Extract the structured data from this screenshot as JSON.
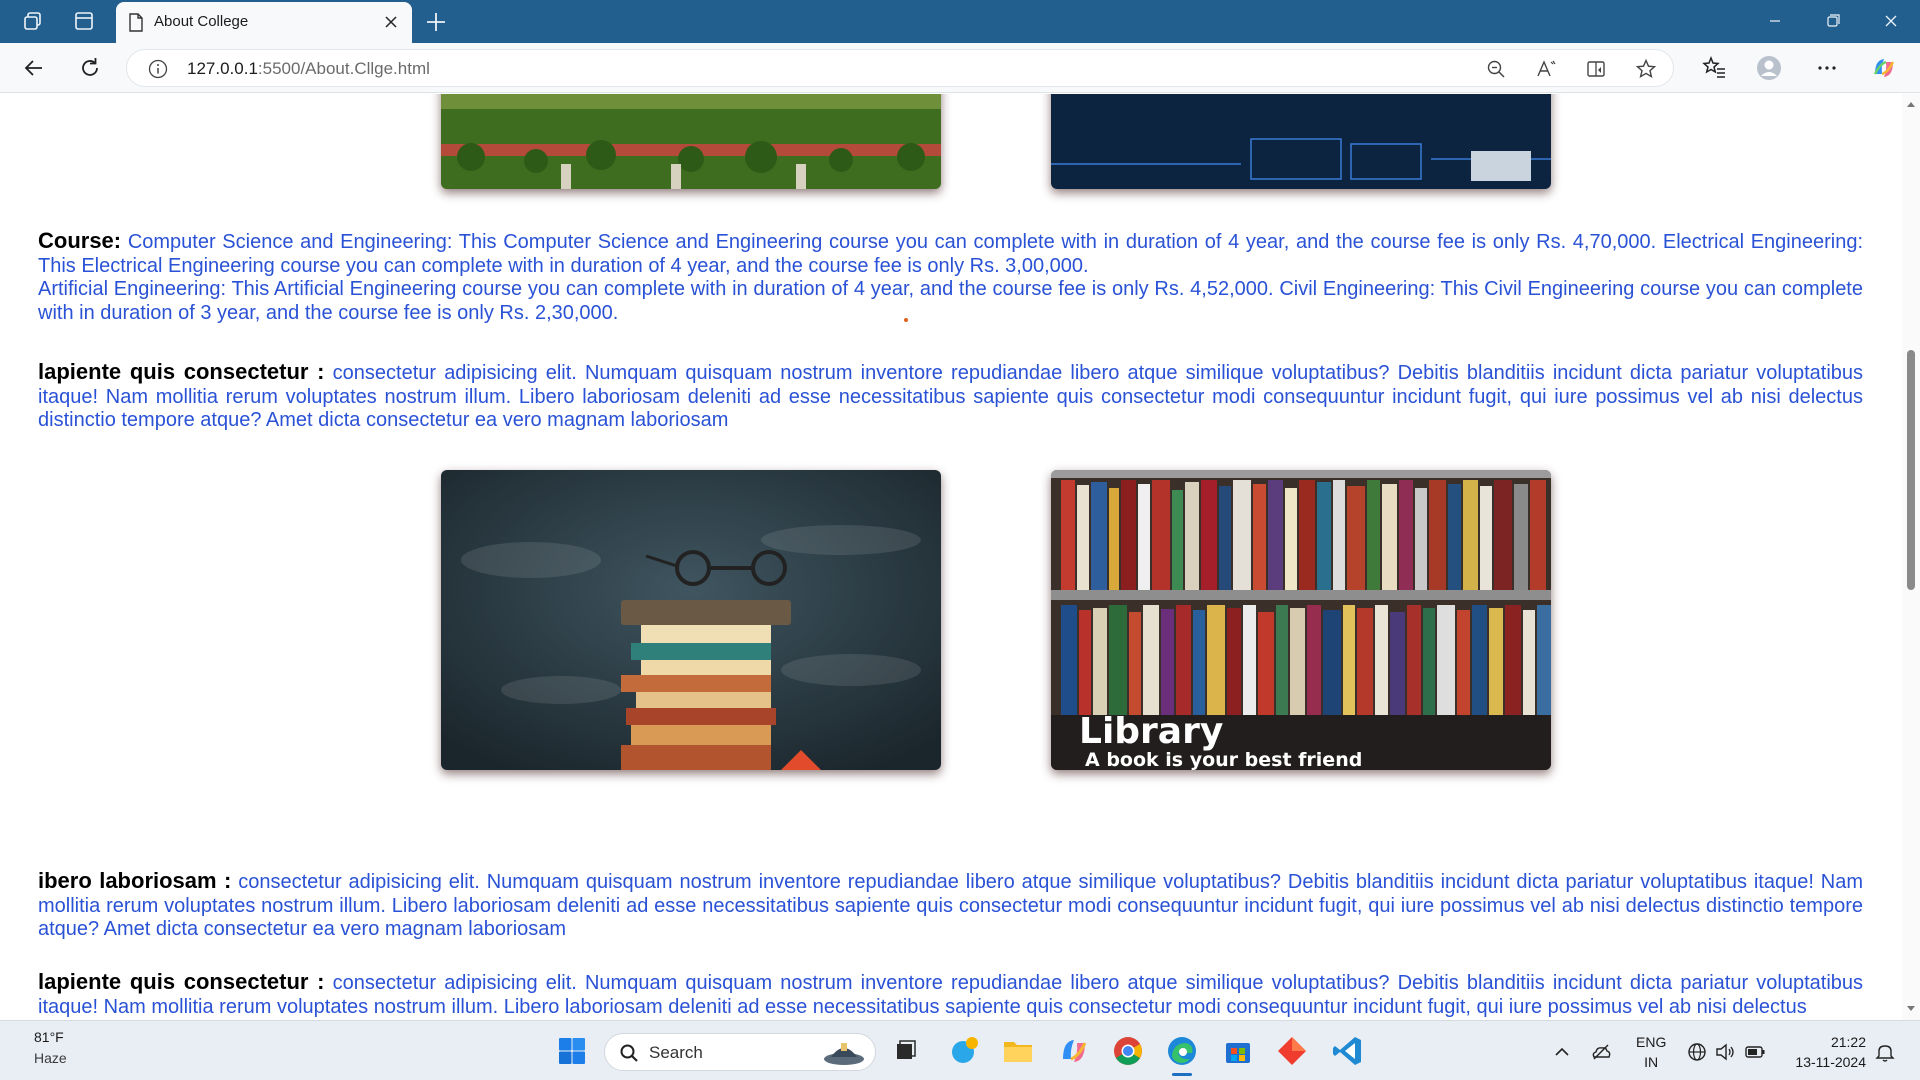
{
  "browser": {
    "tab_title": "About College",
    "url_host": "127.0.0.1",
    "url_rest": ":5500/About.Cllge.html"
  },
  "page": {
    "course_label": "Course:",
    "course_text_1": "Computer Science and Engineering: This Computer Science and Engineering course you can complete with in duration of 4 year, and the course fee is only Rs. 4,70,000. Electrical Engineering: This Electrical Engineering course you can complete with in duration of 4 year, and the course fee is only Rs. 3,00,000.",
    "course_text_2": "Artificial Engineering: This Artificial Engineering course you can complete with in duration of 4 year, and the course fee is only Rs. 4,52,000. Civil Engineering: This Civil Engineering course you can complete with in duration of 3 year, and the course fee is only Rs. 2,30,000.",
    "para1_label": "lapiente quis consectetur :",
    "para1_text": "consectetur adipisicing elit. Numquam quisquam nostrum inventore repudiandae libero atque similique voluptatibus? Debitis blanditiis incidunt dicta pariatur voluptatibus itaque! Nam mollitia rerum voluptates nostrum illum. Libero laboriosam deleniti ad esse necessitatibus sapiente quis consectetur modi consequuntur incidunt fugit, qui iure possimus vel ab nisi delectus distinctio tempore atque? Amet dicta consectetur ea vero magnam laboriosam",
    "library_title": "Library",
    "library_subtitle": "A book is your best friend",
    "para2_label": "ibero laboriosam :",
    "para2_text": "consectetur adipisicing elit. Numquam quisquam nostrum inventore repudiandae libero atque similique voluptatibus? Debitis blanditiis incidunt dicta pariatur voluptatibus itaque! Nam mollitia rerum voluptates nostrum illum. Libero laboriosam deleniti ad esse necessitatibus sapiente quis consectetur modi consequuntur incidunt fugit, qui iure possimus vel ab nisi delectus distinctio tempore atque? Amet dicta consectetur ea vero magnam laboriosam",
    "para3_label": "lapiente quis consectetur :",
    "para3_text": "consectetur adipisicing elit. Numquam quisquam nostrum inventore repudiandae libero atque similique voluptatibus? Debitis blanditiis incidunt dicta pariatur voluptatibus itaque! Nam mollitia rerum voluptates nostrum illum. Libero laboriosam deleniti ad esse necessitatibus sapiente quis consectetur modi consequuntur incidunt fugit, qui iure possimus vel ab nisi delectus"
  },
  "taskbar": {
    "temperature": "81°F",
    "weather": "Haze",
    "search_placeholder": "Search",
    "lang_1": "ENG",
    "lang_2": "IN",
    "time": "21:22",
    "date": "13-11-2024"
  },
  "colors": {
    "titlebar": "#235f8e",
    "link_text": "#2a52d6",
    "taskbar": "#e9eef5"
  },
  "icons": [
    "workspaces-icon",
    "tab-actions-icon",
    "page-icon",
    "close-icon",
    "plus-icon",
    "minimize-icon",
    "restore-icon",
    "back-icon",
    "refresh-icon",
    "info-icon",
    "zoom-out-icon",
    "read-aloud-icon",
    "immersive-reader-icon",
    "star-icon",
    "favorites-icon",
    "profile-icon",
    "more-icon",
    "copilot-icon",
    "windows-start-icon",
    "search-icon",
    "task-view-icon",
    "edge-icon",
    "file-explorer-icon",
    "chrome-icon",
    "store-icon",
    "vscode-icon",
    "chevron-up-icon",
    "onedrive-icon",
    "globe-icon",
    "volume-icon",
    "battery-icon",
    "notification-icon"
  ]
}
